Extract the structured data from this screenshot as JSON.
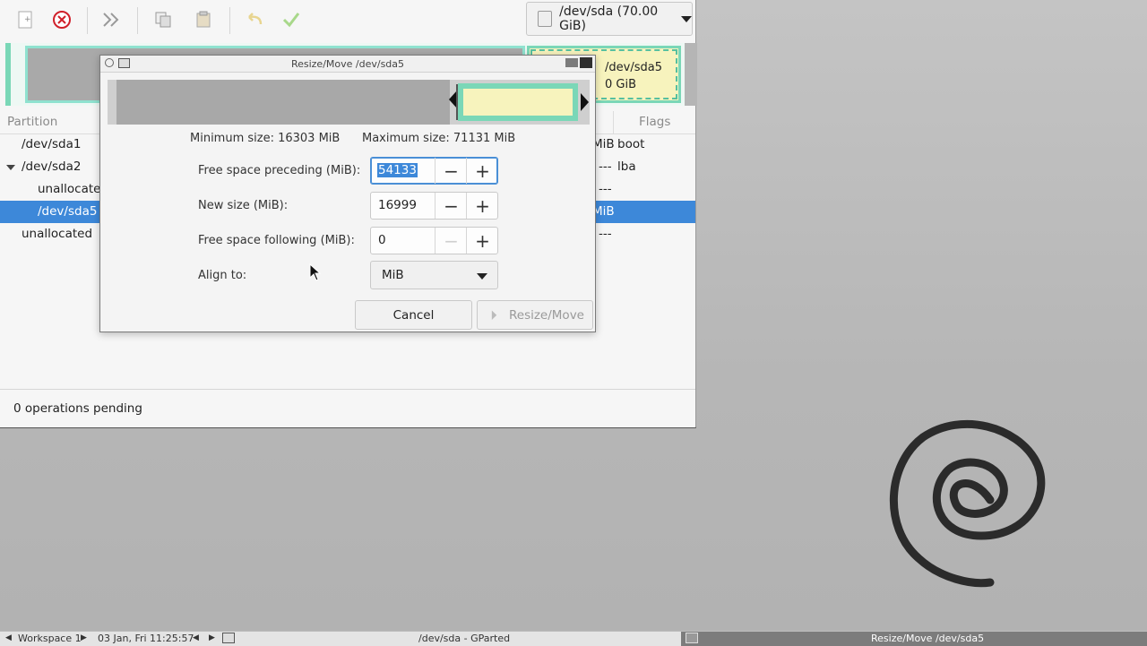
{
  "window": {
    "device_selector": "/dev/sda (70.00 GiB)"
  },
  "disk_map": {
    "selected_name": "/dev/sda5",
    "selected_size": "0 GiB"
  },
  "table": {
    "headers": {
      "partition": "Partition",
      "flags": "Flags"
    },
    "rows": [
      {
        "name": "/dev/sda1",
        "size": "MiB",
        "flag": "boot"
      },
      {
        "name": "/dev/sda2",
        "size": "---",
        "flag": "lba"
      },
      {
        "name": "unallocated",
        "size": "---",
        "flag": ""
      },
      {
        "name": "/dev/sda5",
        "size": "MiB",
        "flag": ""
      },
      {
        "name": "unallocated",
        "size": "---",
        "flag": ""
      }
    ]
  },
  "status": {
    "text": "0 operations pending"
  },
  "dialog": {
    "title": "Resize/Move /dev/sda5",
    "min_size": "Minimum size: 16303 MiB",
    "max_size": "Maximum size: 71131 MiB",
    "fields": {
      "preceding_label": "Free space preceding (MiB):",
      "preceding_value": "54133",
      "newsize_label": "New size (MiB):",
      "newsize_value": "16999",
      "following_label": "Free space following (MiB):",
      "following_value": "0",
      "align_label": "Align to:",
      "align_value": "MiB"
    },
    "buttons": {
      "cancel": "Cancel",
      "resize": "Resize/Move"
    }
  },
  "taskbar": {
    "workspace": "Workspace 1",
    "clock": "03 Jan, Fri 11:25:57",
    "task_main": "/dev/sda - GParted",
    "task_active": "Resize/Move /dev/sda5"
  },
  "colors": {
    "selection": "#3d88d9",
    "partition_border": "#7ad7b7",
    "partition_fill": "#f7f3bd"
  }
}
